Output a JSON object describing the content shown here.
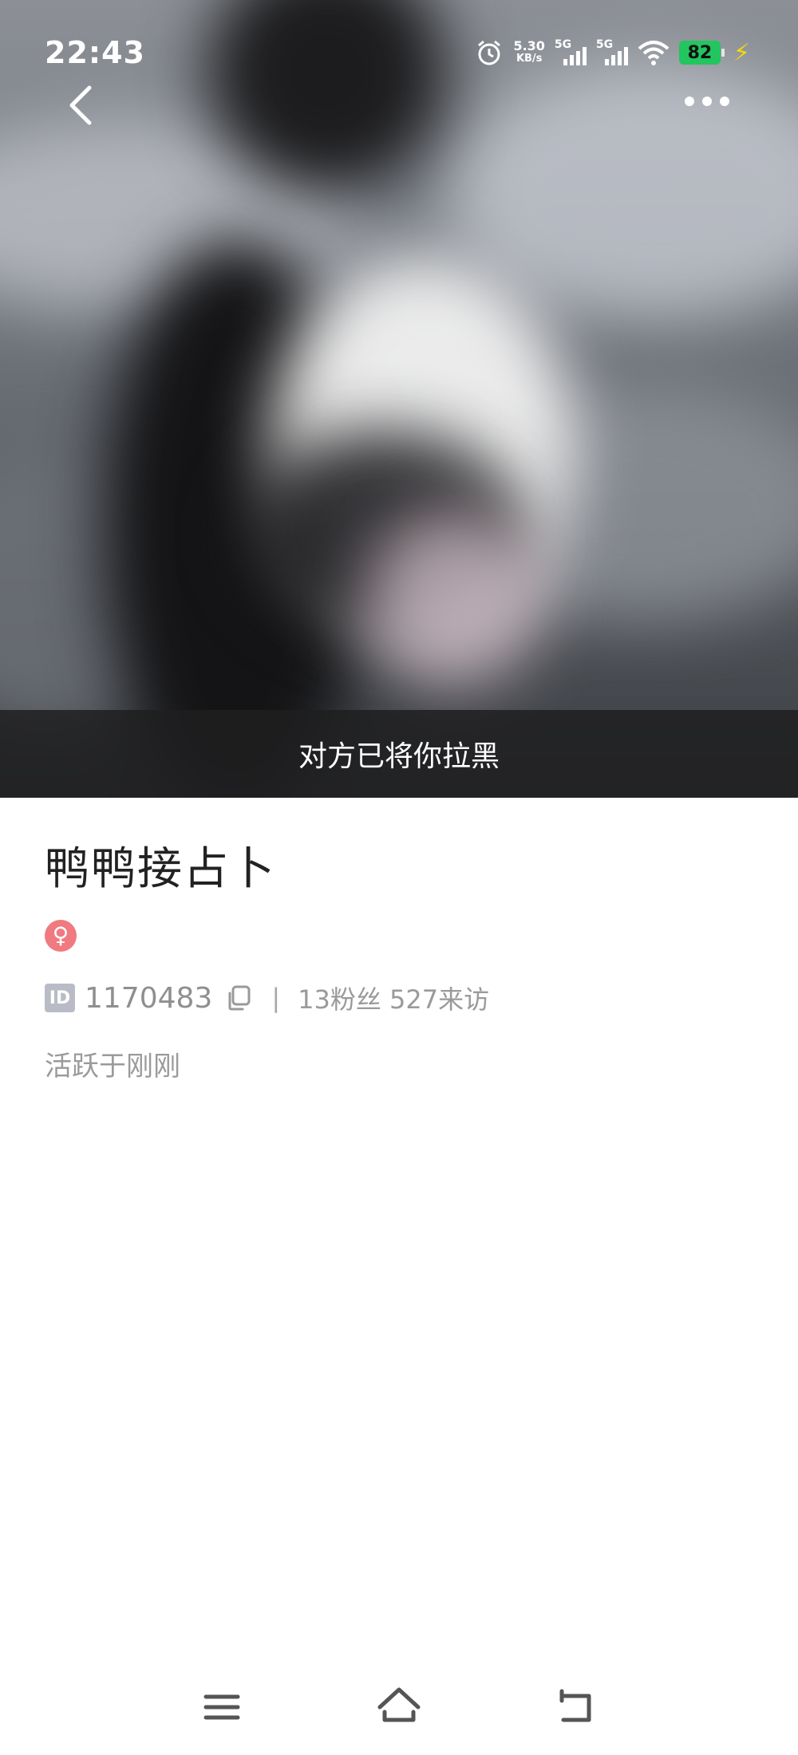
{
  "status_bar": {
    "time": "22:43",
    "net_speed_value": "5.30",
    "net_speed_unit": "KB/s",
    "sim1_label": "5G",
    "sim2_label": "5G",
    "battery_level": "82",
    "icons": [
      "alarm-icon",
      "signal-icon",
      "signal-icon",
      "wifi-icon",
      "battery-icon",
      "charging-icon"
    ]
  },
  "hero": {
    "blocked_notice": "对方已将你拉黑"
  },
  "profile": {
    "name": "鸭鸭接占卜",
    "gender_symbol": "♀",
    "id_badge": "ID",
    "id_value": "1170483",
    "separator": "|",
    "stats": "13粉丝 527来访",
    "active_status": "活跃于刚刚"
  },
  "colors": {
    "gender_badge": "#f07a7f",
    "battery": "#22c55e",
    "id_badge": "#b9bcc6"
  }
}
